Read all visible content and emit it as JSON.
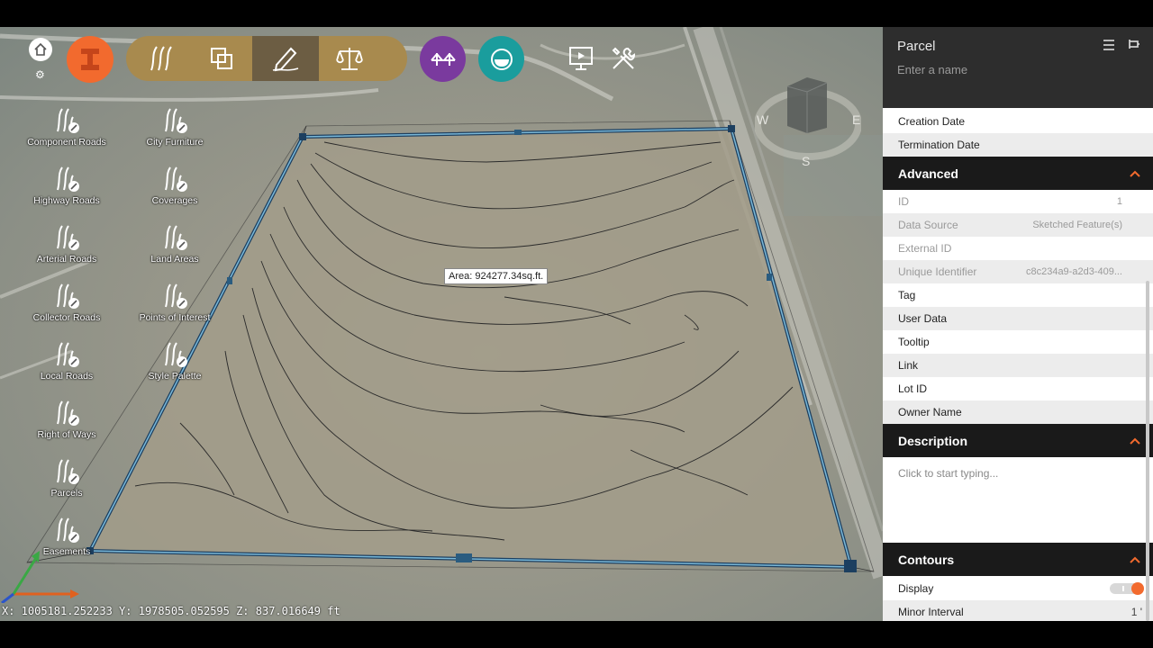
{
  "toolbar": {
    "home_icon": "home-icon",
    "settings_icon": "gear-icon",
    "modes": [
      "roads-mode",
      "layers-mode",
      "sketch-mode",
      "analyze-mode"
    ],
    "active_mode": "sketch-mode",
    "accent_orange": "#f26a2e",
    "mode_bar_color": "#a88a4e",
    "purple_color": "#7a3a9e",
    "teal_color": "#1a9d9d"
  },
  "assets": [
    {
      "label": "Component Roads",
      "icon": "component-roads-icon"
    },
    {
      "label": "City Furniture",
      "icon": "city-furniture-icon"
    },
    {
      "label": "Highway Roads",
      "icon": "highway-roads-icon"
    },
    {
      "label": "Coverages",
      "icon": "coverages-icon"
    },
    {
      "label": "Arterial Roads",
      "icon": "arterial-roads-icon"
    },
    {
      "label": "Land Areas",
      "icon": "land-areas-icon"
    },
    {
      "label": "Collector Roads",
      "icon": "collector-roads-icon"
    },
    {
      "label": "Points of Interest",
      "icon": "points-of-interest-icon"
    },
    {
      "label": "Local Roads",
      "icon": "local-roads-icon"
    },
    {
      "label": "Style Palette",
      "icon": "style-palette-icon"
    },
    {
      "label": "Right of Ways",
      "icon": "right-of-ways-icon"
    },
    {
      "label": "Parcels",
      "icon": "parcels-icon"
    },
    {
      "label": "Easements",
      "icon": "easements-icon"
    }
  ],
  "viewport": {
    "area_tooltip": "Area: 924277.34sq.ft.",
    "coordinates": "X: 1005181.252233  Y: 1978505.052595  Z: 837.016649 ft",
    "compass": {
      "n": "N",
      "e": "E",
      "s": "S",
      "w": "W"
    }
  },
  "panel": {
    "title": "Parcel",
    "name_placeholder": "Enter a name",
    "top_rows": [
      {
        "label": "Creation Date",
        "value": ""
      },
      {
        "label": "Termination Date",
        "value": ""
      }
    ],
    "advanced": {
      "title": "Advanced",
      "readonly_rows": [
        {
          "label": "ID",
          "value": "1"
        },
        {
          "label": "Data Source",
          "value": "Sketched Feature(s)"
        },
        {
          "label": "External ID",
          "value": ""
        },
        {
          "label": "Unique Identifier",
          "value": "c8c234a9-a2d3-409..."
        }
      ],
      "rows": [
        {
          "label": "Tag",
          "value": ""
        },
        {
          "label": "User Data",
          "value": ""
        },
        {
          "label": "Tooltip",
          "value": ""
        },
        {
          "label": "Link",
          "value": ""
        },
        {
          "label": "Lot ID",
          "value": ""
        },
        {
          "label": "Owner Name",
          "value": ""
        }
      ]
    },
    "description": {
      "title": "Description",
      "placeholder": "Click to start typing..."
    },
    "contours": {
      "title": "Contours",
      "display_label": "Display",
      "display_on": true,
      "minor_interval_label": "Minor Interval",
      "minor_interval_value": "1 '"
    }
  }
}
